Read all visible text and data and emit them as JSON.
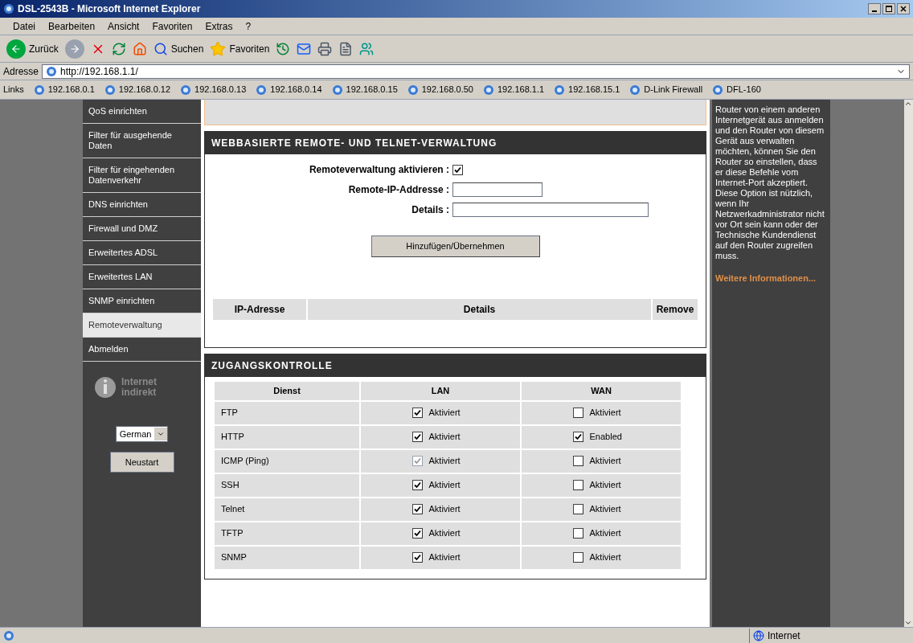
{
  "window": {
    "title": "DSL-2543B - Microsoft Internet Explorer"
  },
  "menu": [
    "Datei",
    "Bearbeiten",
    "Ansicht",
    "Favoriten",
    "Extras",
    "?"
  ],
  "toolbar": {
    "back": "Zurück",
    "search": "Suchen",
    "favorites": "Favoriten"
  },
  "address": {
    "label": "Adresse",
    "value": "http://192.168.1.1/"
  },
  "links": {
    "label": "Links",
    "items": [
      "192.168.0.1",
      "192.168.0.12",
      "192.168.0.13",
      "192.168.0.14",
      "192.168.0.15",
      "192.168.0.50",
      "192.168.1.1",
      "192.168.15.1",
      "D-Link Firewall",
      "DFL-160"
    ]
  },
  "sidebar": {
    "items": [
      {
        "label": "QoS einrichten",
        "selected": false
      },
      {
        "label": "Filter für ausgehende Daten",
        "selected": false
      },
      {
        "label": "Filter für eingehenden Datenverkehr",
        "selected": false
      },
      {
        "label": "DNS einrichten",
        "selected": false
      },
      {
        "label": "Firewall und DMZ",
        "selected": false
      },
      {
        "label": "Erweitertes ADSL",
        "selected": false
      },
      {
        "label": "Erweitertes LAN",
        "selected": false
      },
      {
        "label": "SNMP einrichten",
        "selected": false
      },
      {
        "label": "Remoteverwaltung",
        "selected": true
      },
      {
        "label": "Abmelden",
        "selected": false
      }
    ],
    "logo": [
      "Internet",
      "indirekt"
    ],
    "language": "German",
    "restart": "Neustart"
  },
  "remote": {
    "title": "WEBBASIERTE REMOTE- UND TELNET-VERWALTUNG",
    "enable": {
      "label": "Remoteverwaltung aktivieren :",
      "checked": true
    },
    "ip": {
      "label": "Remote-IP-Addresse :"
    },
    "details": {
      "label": "Details :"
    },
    "button": "Hinzufügen/Übernehmen",
    "columns": [
      "IP-Adresse",
      "Details",
      "Remove"
    ]
  },
  "access": {
    "title": "ZUGANGSKONTROLLE",
    "columns": [
      "Dienst",
      "LAN",
      "WAN"
    ],
    "rows": [
      {
        "service": "FTP",
        "lan": {
          "checked": true,
          "disabled": false,
          "label": "Aktiviert"
        },
        "wan": {
          "checked": false,
          "label": "Aktiviert"
        }
      },
      {
        "service": "HTTP",
        "lan": {
          "checked": true,
          "disabled": false,
          "label": "Aktiviert"
        },
        "wan": {
          "checked": true,
          "label": "Enabled"
        }
      },
      {
        "service": "ICMP (Ping)",
        "lan": {
          "checked": true,
          "disabled": true,
          "label": "Aktiviert"
        },
        "wan": {
          "checked": false,
          "label": "Aktiviert"
        }
      },
      {
        "service": "SSH",
        "lan": {
          "checked": true,
          "disabled": false,
          "label": "Aktiviert"
        },
        "wan": {
          "checked": false,
          "label": "Aktiviert"
        }
      },
      {
        "service": "Telnet",
        "lan": {
          "checked": true,
          "disabled": false,
          "label": "Aktiviert"
        },
        "wan": {
          "checked": false,
          "label": "Aktiviert"
        }
      },
      {
        "service": "TFTP",
        "lan": {
          "checked": true,
          "disabled": false,
          "label": "Aktiviert"
        },
        "wan": {
          "checked": false,
          "label": "Aktiviert"
        }
      },
      {
        "service": "SNMP",
        "lan": {
          "checked": true,
          "disabled": false,
          "label": "Aktiviert"
        },
        "wan": {
          "checked": false,
          "label": "Aktiviert"
        }
      }
    ]
  },
  "help": {
    "text": "Router von einem anderen Internetgerät aus anmelden und den Router von diesem Gerät aus verwalten möchten, können Sie den Router so einstellen, dass er diese Befehle vom Internet-Port akzeptiert. Diese Option ist nützlich, wenn Ihr Netzwerkadministrator nicht vor Ort sein kann oder der Technische Kundendienst auf den Router zugreifen muss.",
    "link": "Weitere Informationen..."
  },
  "status_bar": {
    "zone": "Internet"
  }
}
